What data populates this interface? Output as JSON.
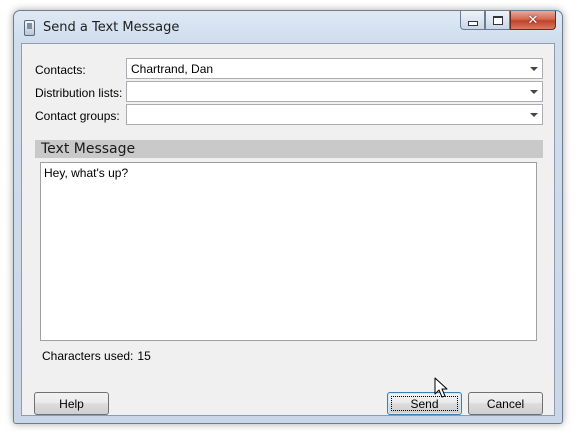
{
  "window": {
    "title": "Send a Text Message",
    "close_glyph": "✕"
  },
  "fields": {
    "contacts": {
      "label": "Contacts:",
      "value": "Chartrand, Dan"
    },
    "distribution_lists": {
      "label": "Distribution lists:",
      "value": ""
    },
    "contact_groups": {
      "label": "Contact groups:",
      "value": ""
    }
  },
  "message": {
    "section_title": "Text Message",
    "body": "Hey, what's up?",
    "chars_label": "Characters used:",
    "chars_value": "15"
  },
  "buttons": {
    "help": "Help",
    "send": "Send",
    "cancel": "Cancel"
  },
  "icons": {
    "app": "phone-icon",
    "minimize": "minimize-icon",
    "maximize": "maximize-icon",
    "close": "close-icon",
    "cursor": "mouse-pointer-icon"
  },
  "colors": {
    "title_bar": "#cfdded",
    "close_button": "#c0432b",
    "section_header": "#c9c9c9",
    "default_button_border": "#3c7fb1"
  }
}
